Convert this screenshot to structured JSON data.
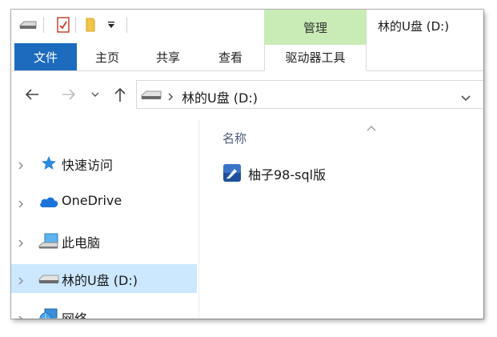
{
  "title_bar": {
    "window_title": "林的U盘 (D:)",
    "contextual_group": "管理",
    "quick_access": [
      "drive-icon",
      "properties-icon",
      "folder-icon",
      "dropdown-icon"
    ]
  },
  "ribbon": {
    "tabs": [
      {
        "label": "文件",
        "active": true
      },
      {
        "label": "主页"
      },
      {
        "label": "共享"
      },
      {
        "label": "查看"
      },
      {
        "label": "驱动器工具"
      }
    ],
    "file_tab_color": "#1d6bbf",
    "manage_color": "#c9ecb6"
  },
  "nav": {
    "back_icon": "arrow-left-icon",
    "forward_icon": "arrow-right-icon",
    "recent_icon": "chevron-down-icon",
    "up_icon": "arrow-up-icon"
  },
  "address_bar": {
    "icon": "usb-drive-icon",
    "path": "林的U盘 (D:)"
  },
  "sidebar": {
    "items": [
      {
        "label": "快速访问",
        "icon": "star-icon"
      },
      {
        "label": "OneDrive",
        "icon": "cloud-icon"
      },
      {
        "label": "此电脑",
        "icon": "computer-icon"
      },
      {
        "label": "林的U盘 (D:)",
        "icon": "usb-drive-icon",
        "selected": true
      },
      {
        "label": "网络",
        "icon": "network-icon"
      }
    ],
    "selected_color": "#cce8ff"
  },
  "content": {
    "column_header": "名称",
    "files": [
      {
        "name": "柚子98-sql版",
        "icon": "shortcut-app-icon"
      }
    ]
  }
}
